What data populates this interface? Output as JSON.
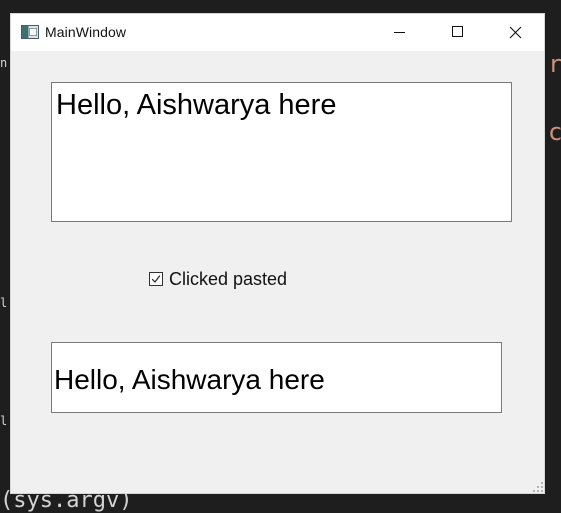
{
  "background": {
    "side_fragments": [
      {
        "text": "n",
        "style": "small"
      },
      {
        "text": "l",
        "style": "small"
      },
      {
        "text": "l",
        "style": "small"
      },
      {
        "text": "r",
        "style": "orange"
      },
      {
        "text": "c",
        "style": "orange"
      }
    ],
    "bottom_code": "(sys.argv)"
  },
  "window": {
    "title": "MainWindow",
    "icon": "app-window-icon",
    "controls": {
      "minimize": "minimize-icon",
      "maximize": "maximize-icon",
      "close": "close-icon"
    }
  },
  "content": {
    "text_edit_value": "Hello, Aishwarya here",
    "checkbox": {
      "label": "Clicked pasted",
      "checked": true
    },
    "line_edit_value": "Hello, Aishwarya here"
  },
  "colors": {
    "editor_background": "#1e1e1e",
    "window_background": "#f0f0f0",
    "titlebar_background": "#ffffff",
    "field_border": "#7a7a7a",
    "code_accent": "#ce9178"
  }
}
